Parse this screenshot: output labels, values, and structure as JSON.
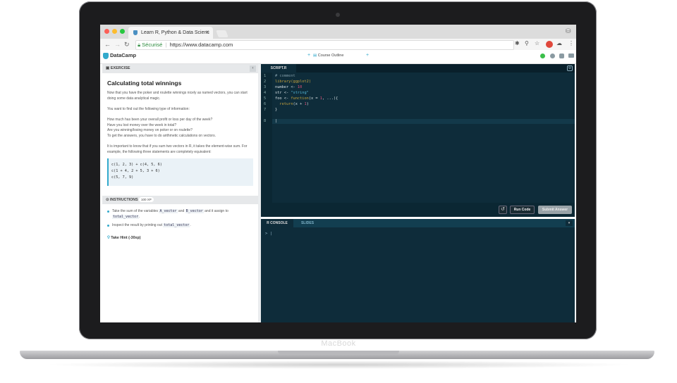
{
  "laptop": {
    "brand": "MacBook"
  },
  "browser": {
    "tab_title": "Learn R, Python & Data Scienc",
    "tab_close": "×",
    "secure_label": "Sécurisé",
    "url": "https://www.datacamp.com",
    "nav_back": "←",
    "nav_forward": "→",
    "nav_reload": "↻"
  },
  "app": {
    "logo": "DataCamp",
    "course_outline": "Course Outline",
    "prev": "+",
    "next": "+"
  },
  "exercise": {
    "header": "EXERCISE",
    "title": "Calculating total winnings",
    "paragraphs": [
      "Now that you have the poker and roulette winnings nicely as named vectors, you can start doing some data analytical magic.",
      "You want to find out the following type of information:",
      "How much has been your overall profit or loss per day of the week?",
      "Have you lost money over the week in total?",
      "Are you winning/losing money on poker or on roulette?",
      "To get the answers, you have to do arithmetic calculations on vectors.",
      "It is important to know that if you sum two vectors in R, it takes the element-wise sum. For example, the following three statements are completely equivalent:"
    ],
    "code": [
      "c(1, 2, 3) + c(4, 5, 6)",
      "c(1 + 4, 2 + 5, 3 + 6)",
      "c(5, 7, 9)"
    ]
  },
  "instructions": {
    "header": "INSTRUCTIONS",
    "xp": "100 XP",
    "items": [
      {
        "a": "Take the sum of the variables ",
        "b": "A_vector",
        "c": " and ",
        "d": "B_vector",
        "e": " and it assign to ",
        "f": "total_vector",
        "g": "."
      },
      {
        "a": "Inspect the result by printing out ",
        "b": "total_vector",
        "c": "."
      }
    ],
    "hint": "Take Hint (-30xp)"
  },
  "editor": {
    "tab": "SCRIPT.R",
    "lines": [
      "1",
      "2",
      "3",
      "4",
      "5",
      "6",
      "7",
      "8"
    ],
    "code": [
      {
        "text": "# comment",
        "color": "#7f9aa6"
      },
      {
        "text": "library(ggplot2)",
        "color": "#c7a33c"
      },
      {
        "text": "number <- 10",
        "color": "#d8e0e3",
        "accent": "10",
        "accent_color": "#e0507a"
      },
      {
        "text": "str <- \"string\"",
        "color": "#d8e0e3",
        "accent": "\"string\"",
        "accent_color": "#55b8d8"
      },
      {
        "text": "foo <- function(x = 1, ...){",
        "color": "#d8e0e3"
      },
      {
        "text": "  return(x + 1)",
        "color": "#c7a33c"
      },
      {
        "text": "}",
        "color": "#d8e0e3"
      },
      {
        "text": "|",
        "color": "#d8e0e3"
      }
    ],
    "reset": "↺",
    "run": "Run Code",
    "submit": "Submit Answer"
  },
  "console": {
    "tabs": [
      "R CONSOLE",
      "SLIDES"
    ],
    "prompt": "> |",
    "toggle": "▾"
  },
  "colors": {
    "accent": "#33aacc",
    "editor_bg": "#0e2c3a",
    "run_bg": "#1a2b33",
    "submit_bg": "#9aa3a8"
  }
}
